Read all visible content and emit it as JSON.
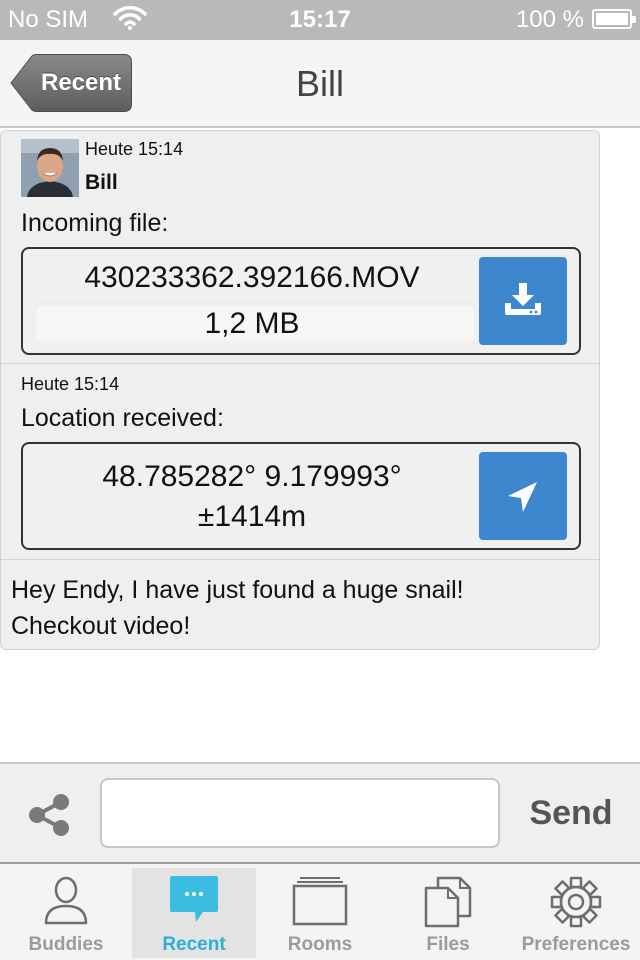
{
  "status_bar": {
    "carrier": "No SIM",
    "time": "15:17",
    "battery": "100 %"
  },
  "nav": {
    "back_label": "Recent",
    "title": "Bill"
  },
  "messages": [
    {
      "type": "file",
      "time": "Heute 15:14",
      "sender": "Bill",
      "heading": "Incoming file:",
      "file_name": "430233362.392166.MOV",
      "file_size": "1,2 MB",
      "action_icon": "download-icon"
    },
    {
      "type": "location",
      "time": "Heute 15:14",
      "heading": "Location received:",
      "coordinates": "48.785282° 9.179993°",
      "accuracy": "±1414m",
      "action_icon": "location-arrow-icon"
    },
    {
      "type": "text",
      "text_line1": "Hey Endy, I have just found a huge snail!",
      "text_line2": "Checkout video!"
    }
  ],
  "composer": {
    "input_value": "",
    "input_placeholder": "",
    "send_label": "Send"
  },
  "tabs": [
    {
      "label": "Buddies",
      "icon": "person-icon",
      "active": false
    },
    {
      "label": "Recent",
      "icon": "chat-bubble-icon",
      "active": true
    },
    {
      "label": "Rooms",
      "icon": "rooms-icon",
      "active": false
    },
    {
      "label": "Files",
      "icon": "files-icon",
      "active": false
    },
    {
      "label": "Preferences",
      "icon": "gear-icon",
      "active": false
    }
  ],
  "colors": {
    "accent": "#2cb0d6",
    "action_button": "#3d87cf",
    "back_button": "#6d6d6d",
    "status_bar": "#b9b9b9"
  }
}
